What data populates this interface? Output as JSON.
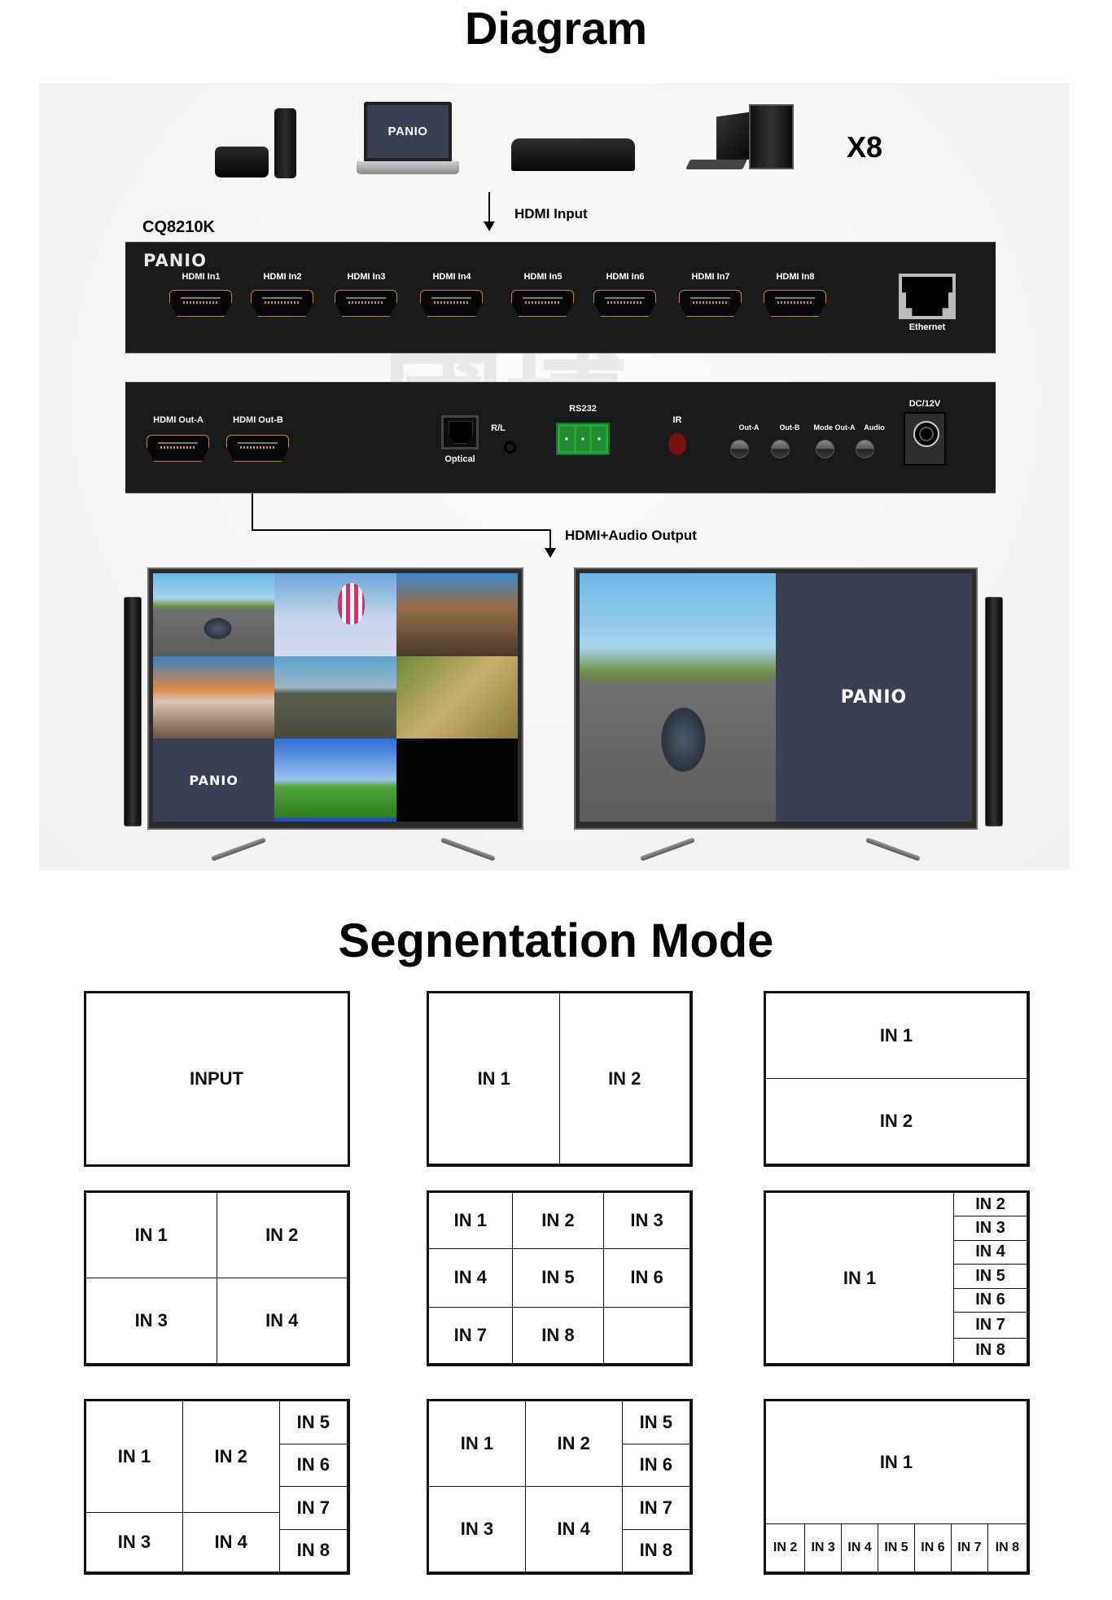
{
  "titles": {
    "diagram": "Diagram",
    "segmentation": "Segnentation Mode"
  },
  "sources": {
    "devices": [
      "apple-tv",
      "laptop",
      "media-player",
      "desktop-pc"
    ],
    "laptop_brand": "PANIO",
    "multiplier": "X8",
    "arrow_label": "HDMI Input"
  },
  "device": {
    "model": "CQ8210K",
    "brand": "PANIO",
    "front_panel": {
      "inputs": [
        "HDMI In1",
        "HDMI In2",
        "HDMI In3",
        "HDMI In4",
        "HDMI In5",
        "HDMI In6",
        "HDMI In7",
        "HDMI In8"
      ],
      "ethernet": "Ethernet"
    },
    "back_panel": {
      "outputs": [
        "HDMI Out-A",
        "HDMI Out-B"
      ],
      "optical": "Optical",
      "rl": "R/L",
      "rs232": "RS232",
      "ir": "IR",
      "buttons": [
        "Out-A",
        "Out-B",
        "Mode Out-A",
        "Audio"
      ],
      "power": "DC/12V"
    },
    "watermark": "國博"
  },
  "output": {
    "arrow_label": "HDMI+Audio Output",
    "tv_left": {
      "layout": "3x3 (8 inputs)",
      "tiles": [
        "racing game",
        "hot air balloons",
        "strategy game",
        "beach sunset",
        "shooter game",
        "mmo game",
        "PANIO",
        "windows desktop",
        "empty"
      ],
      "logo": "PANIO"
    },
    "tv_right": {
      "layout": "1x2",
      "tiles": [
        "racing game",
        "PANIO"
      ],
      "logo": "PANIO"
    }
  },
  "modes": [
    {
      "id": "full",
      "cells": [
        "INPUT"
      ]
    },
    {
      "id": "split-vertical",
      "cells": [
        "IN 1",
        "IN 2"
      ]
    },
    {
      "id": "split-horizontal",
      "cells": [
        "IN 1",
        "IN 2"
      ]
    },
    {
      "id": "quad",
      "cells": [
        "IN 1",
        "IN 2",
        "IN 3",
        "IN 4"
      ]
    },
    {
      "id": "grid-3x3",
      "cells": [
        "IN 1",
        "IN 2",
        "IN 3",
        "IN 4",
        "IN 5",
        "IN 6",
        "IN 7",
        "IN 8",
        ""
      ]
    },
    {
      "id": "main-plus-side-7",
      "cells": [
        "IN 1",
        "IN 2",
        "IN 3",
        "IN 4",
        "IN 5",
        "IN 6",
        "IN 7",
        "IN 8"
      ]
    },
    {
      "id": "quad-plus-side-4-a",
      "cells": [
        "IN 1",
        "IN 2",
        "IN 3",
        "IN 4",
        "IN 5",
        "IN 6",
        "IN 7",
        "IN 8"
      ]
    },
    {
      "id": "quad-plus-side-4-b",
      "cells": [
        "IN 1",
        "IN 2",
        "IN 3",
        "IN 4",
        "IN 5",
        "IN 6",
        "IN 7",
        "IN 8"
      ]
    },
    {
      "id": "main-plus-bottom-7",
      "cells": [
        "IN 1",
        "IN 2",
        "IN 3",
        "IN 4",
        "IN 5",
        "IN 6",
        "IN 7",
        "IN 8"
      ]
    }
  ]
}
